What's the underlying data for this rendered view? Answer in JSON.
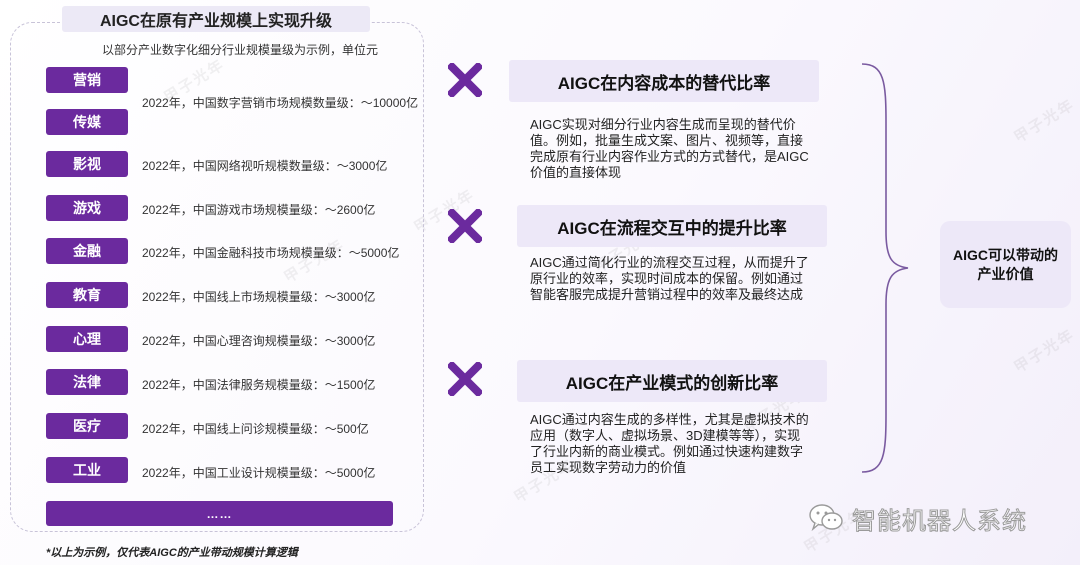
{
  "left": {
    "title": "AIGC在原有产业规模上实现升级",
    "subtitle": "以部分产业数字化细分行业规模量级为示例，单位元",
    "industries": [
      {
        "label": "营销",
        "desc": ""
      },
      {
        "label": "传媒",
        "desc": ""
      },
      {
        "label": "影视",
        "desc": "2022年，中国网络视听规模数量级：～3000亿"
      },
      {
        "label": "游戏",
        "desc": "2022年，中国游戏市场规模量级：～2600亿"
      },
      {
        "label": "金融",
        "desc": "2022年，中国金融科技市场规模量级：～5000亿"
      },
      {
        "label": "教育",
        "desc": "2022年，中国线上市场规模量级：～3000亿"
      },
      {
        "label": "心理",
        "desc": "2022年，中国心理咨询规模量级：～3000亿"
      },
      {
        "label": "法律",
        "desc": "2022年，中国法律服务规模量级：～1500亿"
      },
      {
        "label": "医疗",
        "desc": "2022年，中国线上问诊规模量级：～500亿"
      },
      {
        "label": "工业",
        "desc": "2022年，中国工业设计规模量级：～5000亿"
      }
    ],
    "marketing_media_desc": "2022年，中国数字营销市场规模数量级：～10000亿",
    "more": "……",
    "footnote": "*以上为示例，仅代表AIGC的产业带动规模计算逻辑"
  },
  "ratios": [
    {
      "title": "AIGC在内容成本的替代比率",
      "desc": "AIGC实现对细分行业内容生成而呈现的替代价值。例如，批量生成文案、图片、视频等，直接完成原有行业内容作业方式的方式替代，是AIGC价值的直接体现"
    },
    {
      "title": "AIGC在流程交互中的提升比率",
      "desc": "AIGC通过简化行业的流程交互过程，从而提升了原行业的效率，实现时间成本的保留。例如通过智能客服完成提升营销过程中的效率及最终达成"
    },
    {
      "title": "AIGC在产业模式的创新比率",
      "desc": "AIGC通过内容生成的多样性，尤其是虚拟技术的应用（数字人、虚拟场景、3D建模等等），实现了行业内新的商业模式。例如通过快速构建数字员工实现数字劳动力的价值"
    }
  ],
  "result": {
    "line1": "AIGC可以带动的",
    "line2": "产业价值"
  },
  "source_mark": {
    "text": "智能机器人系统",
    "icon": "wechat-icon"
  },
  "watermark": {
    "text": "甲子光年"
  },
  "colors": {
    "accent": "#6b2a9e",
    "light_box": "#ede8f8",
    "x_mark": "#6b2a9e"
  }
}
